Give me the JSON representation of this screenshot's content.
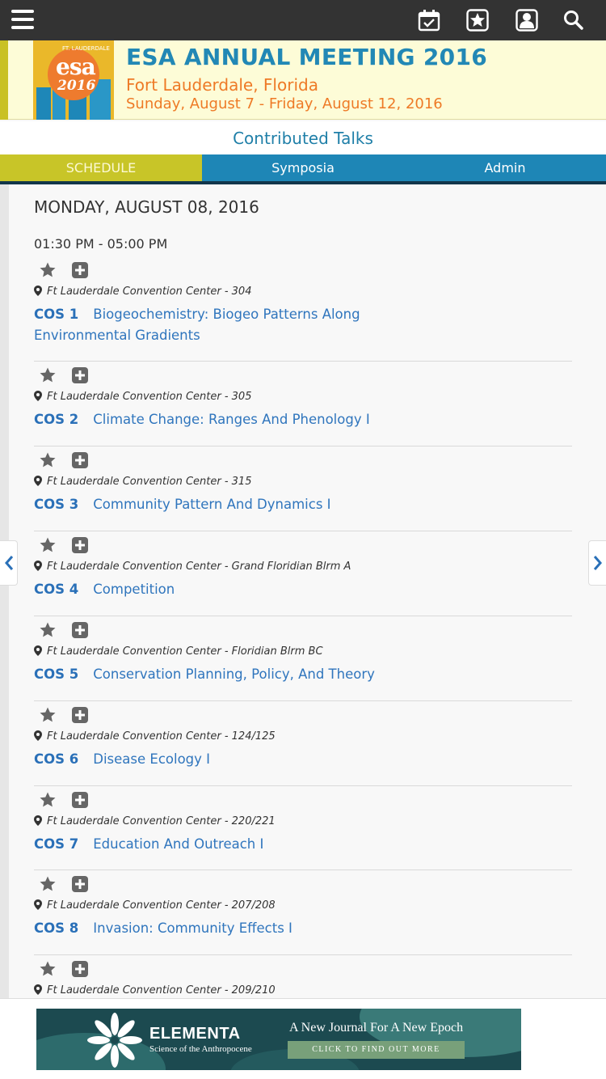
{
  "header": {
    "icons": [
      "menu-icon",
      "calendar-check-icon",
      "star-icon",
      "user-icon",
      "search-icon"
    ]
  },
  "banner": {
    "logo_ft": "FT. LAUDERDALE",
    "logo_esa": "esa",
    "logo_year": "2016",
    "title": "ESA ANNUAL MEETING 2016",
    "city": "Fort Lauderdale, Florida",
    "dates": "Sunday, August 7 - Friday, August 12, 2016",
    "colors": {
      "title": "#2288b5",
      "subtitle": "#ee7a26",
      "background": "#fdfcd7"
    }
  },
  "section_title": "Contributed Talks",
  "tabs": [
    {
      "label": "SCHEDULE",
      "active": true
    },
    {
      "label": "Symposia",
      "active": false
    },
    {
      "label": "Admin",
      "active": false
    }
  ],
  "schedule": {
    "date": "MONDAY, AUGUST 08, 2016",
    "time": "01:30 PM - 05:00 PM",
    "sessions": [
      {
        "code": "COS 1",
        "title": "Biogeochemistry: Biogeo Patterns Along Environmental Gradients",
        "location": "Ft Lauderdale Convention Center - 304"
      },
      {
        "code": "COS 2",
        "title": "Climate Change: Ranges And Phenology I",
        "location": "Ft Lauderdale Convention Center - 305"
      },
      {
        "code": "COS 3",
        "title": "Community Pattern And Dynamics I",
        "location": "Ft Lauderdale Convention Center - 315"
      },
      {
        "code": "COS 4",
        "title": "Competition",
        "location": "Ft Lauderdale Convention Center - Grand Floridian Blrm A"
      },
      {
        "code": "COS 5",
        "title": "Conservation Planning, Policy, And Theory",
        "location": "Ft Lauderdale Convention Center - Floridian Blrm BC"
      },
      {
        "code": "COS 6",
        "title": "Disease Ecology I",
        "location": "Ft Lauderdale Convention Center - 124/125"
      },
      {
        "code": "COS 7",
        "title": "Education And Outreach I",
        "location": "Ft Lauderdale Convention Center - 220/221"
      },
      {
        "code": "COS 8",
        "title": "Invasion: Community Effects I",
        "location": "Ft Lauderdale Convention Center - 207/208"
      },
      {
        "code": "",
        "title": "",
        "location": "Ft Lauderdale Convention Center - 209/210"
      }
    ]
  },
  "ad": {
    "brand": "ELEMENTA",
    "subtitle": "Science of the Anthropocene",
    "tagline": "A New Journal For A New Epoch",
    "button": "CLICK TO FIND OUT MORE"
  }
}
